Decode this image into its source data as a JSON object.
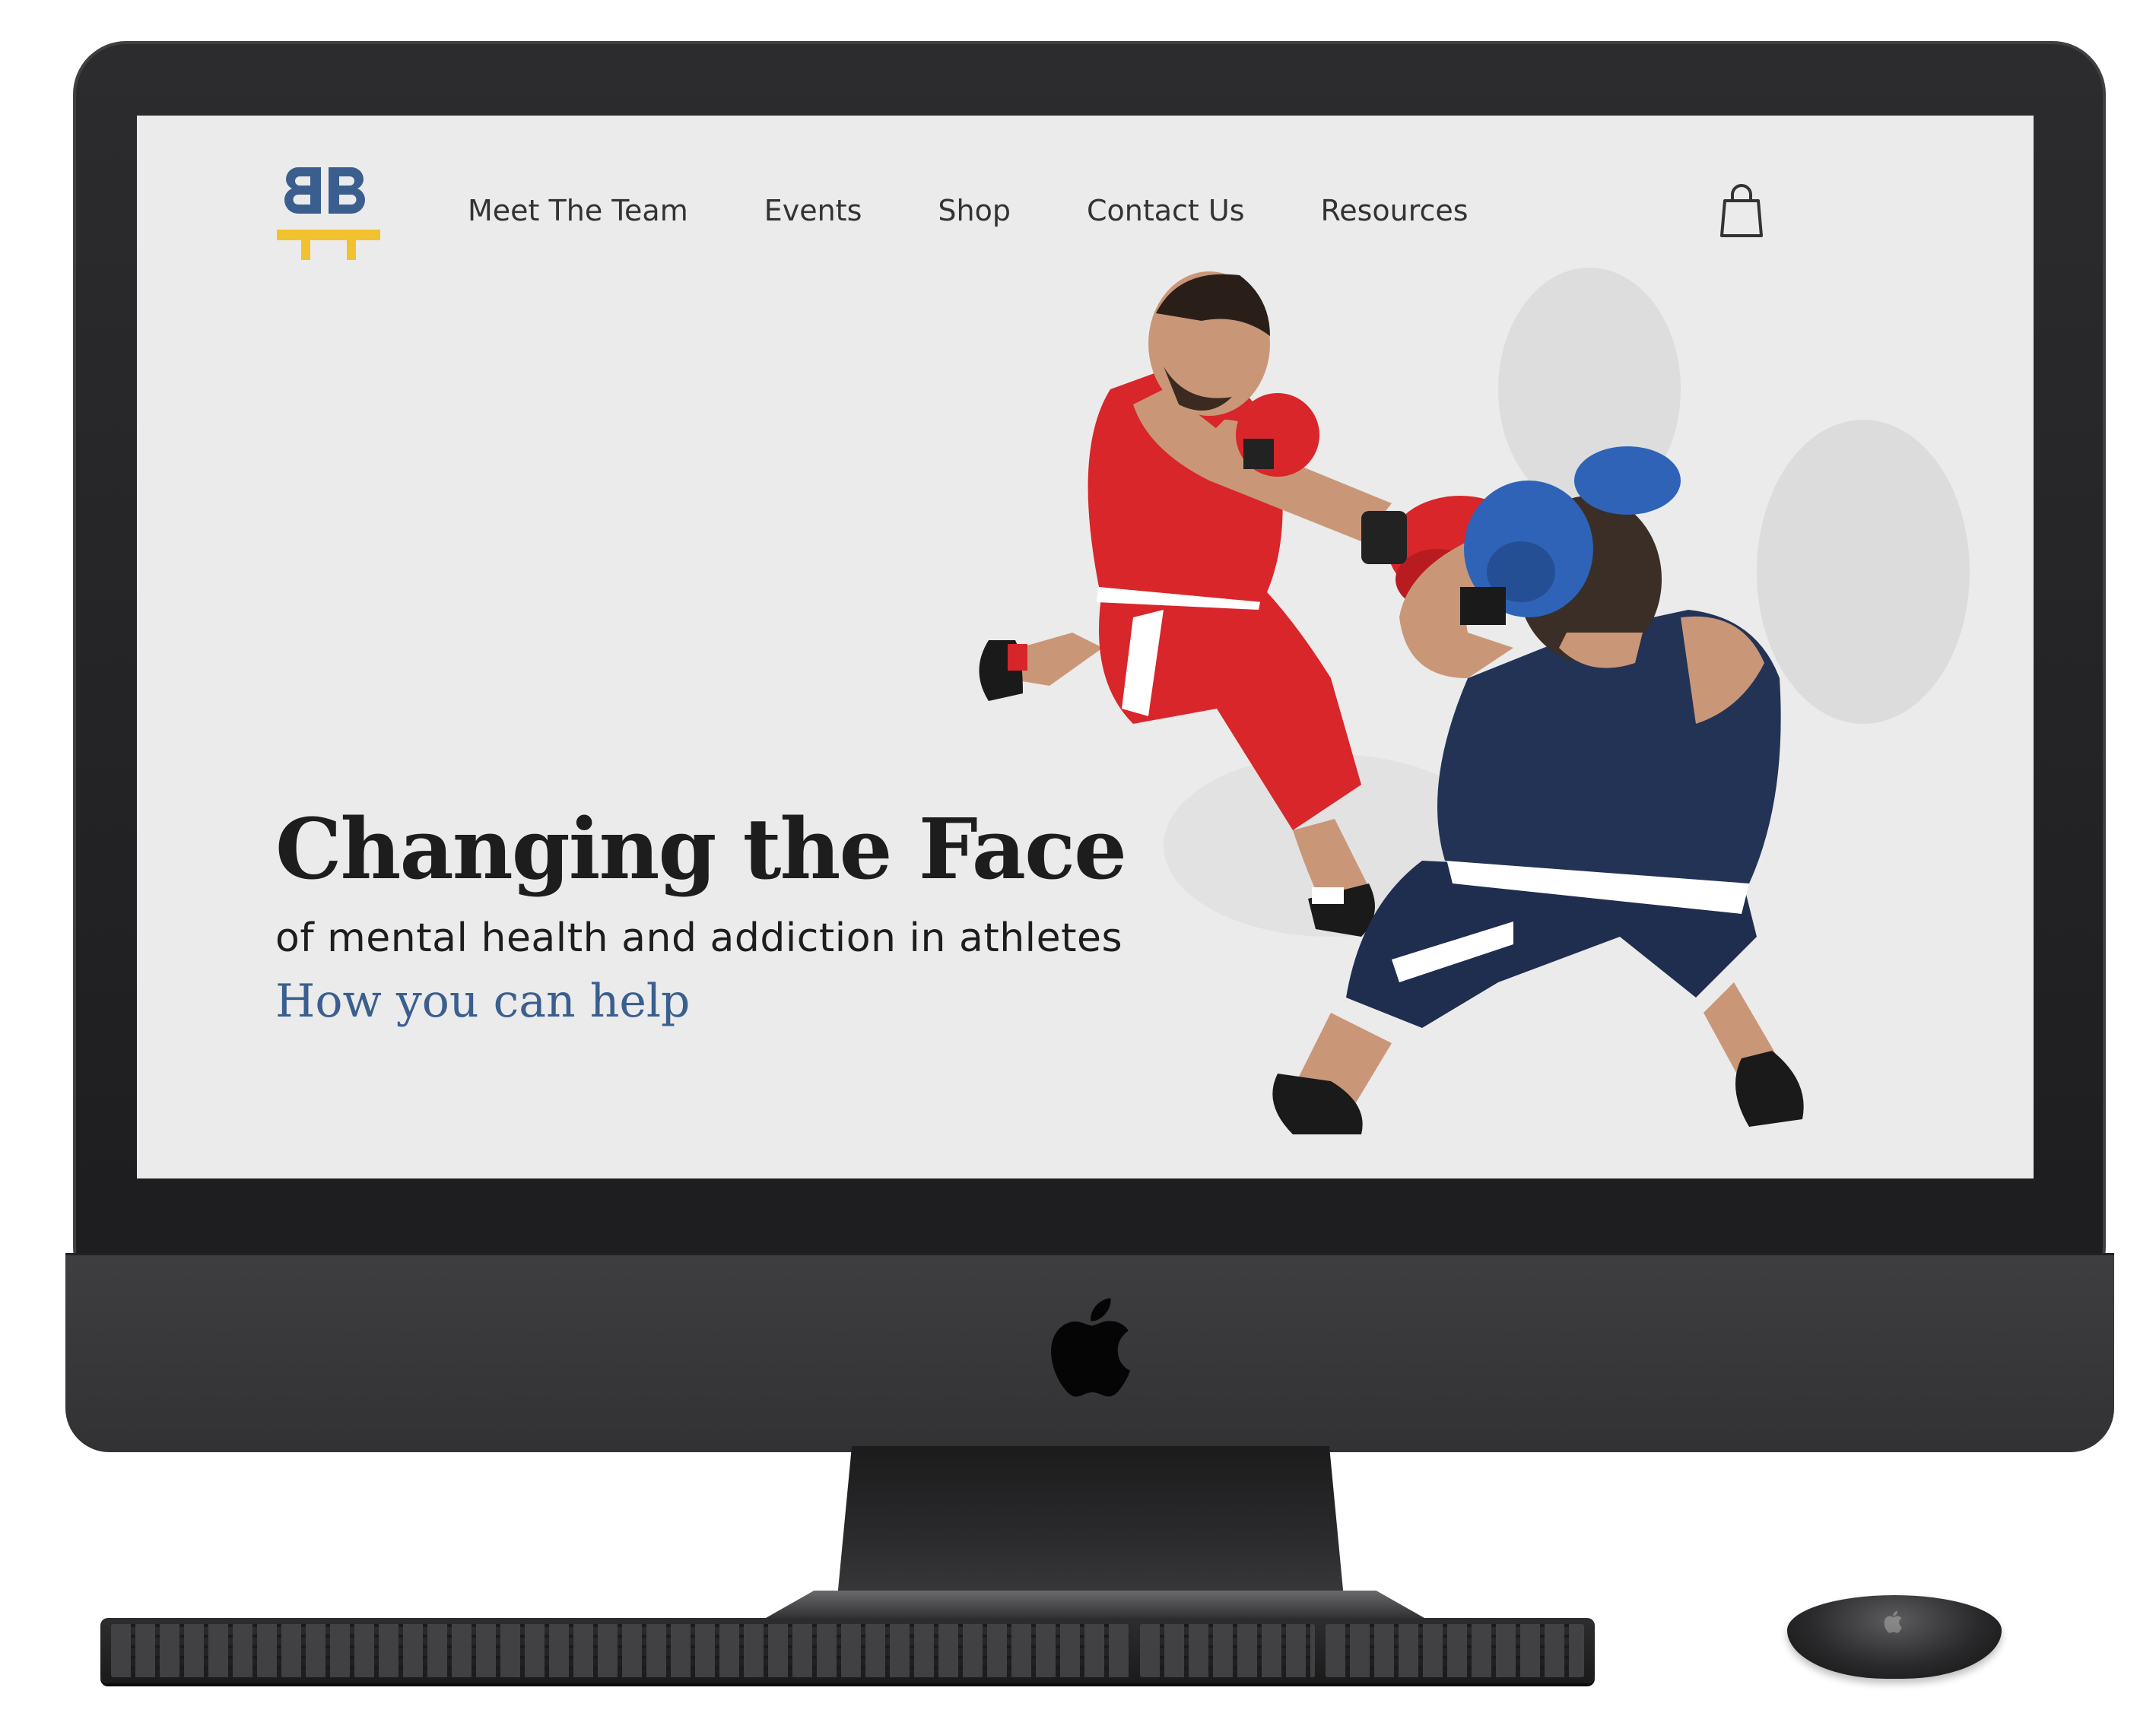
{
  "site": {
    "logo_letters": "BB",
    "brand_colors": {
      "primary_blue": "#3a5f8f",
      "accent_yellow": "#f2c12e"
    }
  },
  "nav": {
    "items": [
      {
        "label": "Meet The Team"
      },
      {
        "label": "Events"
      },
      {
        "label": "Shop"
      },
      {
        "label": "Contact Us"
      },
      {
        "label": "Resources"
      }
    ],
    "cart_icon": "shopping-bag-icon"
  },
  "hero": {
    "title": "Changing the Face",
    "subtitle": "of mental health and addiction in athletes",
    "cta": "How you can help",
    "image": "boxers-sparring-photo"
  },
  "device": {
    "logo_icon": "apple-logo-icon"
  }
}
